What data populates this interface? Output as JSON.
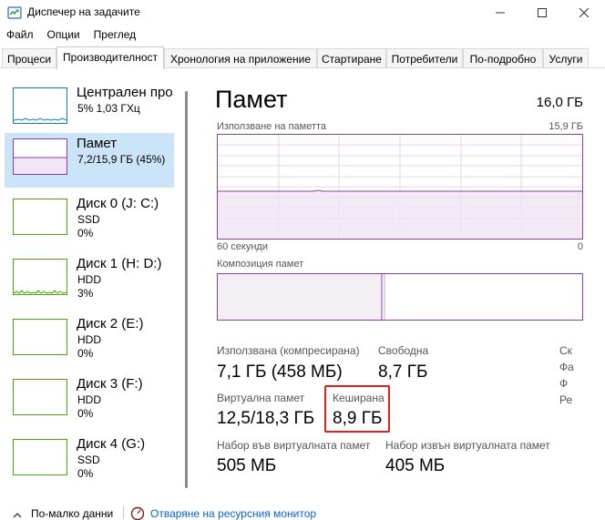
{
  "window": {
    "title": "Диспечер на задачите"
  },
  "menu": [
    "Файл",
    "Опции",
    "Преглед"
  ],
  "tabs": [
    {
      "label": "Процеси"
    },
    {
      "label": "Производителност"
    },
    {
      "label": "Хронология на приложение"
    },
    {
      "label": "Стартиране"
    },
    {
      "label": "Потребители"
    },
    {
      "label": "По-подробно"
    },
    {
      "label": "Услуги"
    }
  ],
  "sidebar": {
    "items": [
      {
        "name": "Централен про",
        "l2": "5%  1,03 ГХц",
        "l3": ""
      },
      {
        "name": "Памет",
        "l2": "7,2/15,9 ГБ (45%)",
        "l3": ""
      },
      {
        "name": "Диск 0 (J: C:)",
        "l2": "SSD",
        "l3": "0%"
      },
      {
        "name": "Диск 1 (H: D:)",
        "l2": "HDD",
        "l3": "3%"
      },
      {
        "name": "Диск 2 (E:)",
        "l2": "HDD",
        "l3": "0%"
      },
      {
        "name": "Диск 3 (F:)",
        "l2": "HDD",
        "l3": "0%"
      },
      {
        "name": "Диск 4 (G:)",
        "l2": "SSD",
        "l3": "0%"
      }
    ]
  },
  "memory": {
    "title": "Памет",
    "total": "16,0 ГБ",
    "usage_label": "Използване на паметта",
    "usage_max": "15,9 ГБ",
    "time_left": "60 секунди",
    "time_right": "0",
    "composition_label": "Композиция памет",
    "stats": {
      "in_use_label": "Използвана (компресирана)",
      "in_use_value": "7,1 ГБ (458 МБ)",
      "available_label": "Свободна",
      "available_value": "8,7 ГБ",
      "committed_label": "Виртуална памет",
      "committed_value": "12,5/18,3 ГБ",
      "cached_label": "Кеширана",
      "cached_value": "8,9 ГБ",
      "paged_label": "Набор във виртуалната памет",
      "paged_value": "505 МБ",
      "nonpaged_label": "Набор извън виртуалната памет",
      "nonpaged_value": "405 МБ",
      "cut_labels": [
        "Ск",
        "Фа",
        "Ф",
        "Ре"
      ]
    }
  },
  "footer": {
    "less_details": "По-малко данни",
    "resource_monitor": "Отваряне на ресурсния монитор"
  },
  "colors": {
    "memory_accent": "#8b3fa8",
    "disk_accent": "#4da60c",
    "cpu_accent": "#117dbb",
    "selected_bg": "#cce4f7",
    "highlight": "#e0201d",
    "link": "#0a64c8"
  }
}
